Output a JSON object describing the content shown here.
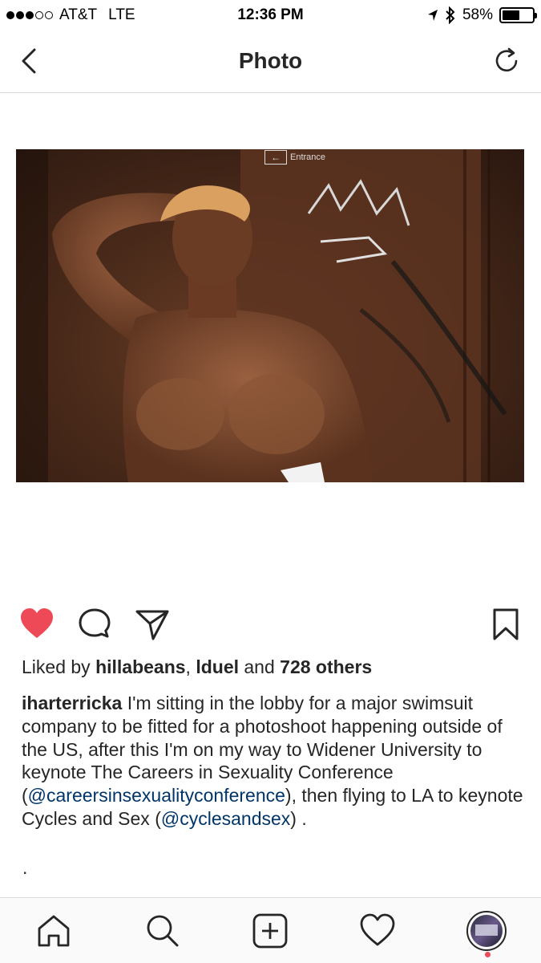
{
  "status_bar": {
    "carrier": "AT&T",
    "network": "LTE",
    "time": "12:36 PM",
    "battery_percent": "58%",
    "battery_level": 0.58,
    "signal_bars_filled": 3,
    "signal_bars_total": 5,
    "icons": [
      "location-arrow-icon",
      "bluetooth-icon",
      "battery-icon"
    ]
  },
  "nav": {
    "title": "Photo",
    "back_icon": "chevron-left-icon",
    "refresh_icon": "refresh-icon"
  },
  "photo": {
    "sign_text": "Entrance",
    "sign_icon": "arrow-left-icon"
  },
  "actions": {
    "like_icon": "heart-filled-icon",
    "like_color": "#ed4956",
    "comment_icon": "comment-icon",
    "share_icon": "paper-plane-icon",
    "save_icon": "bookmark-icon"
  },
  "likes": {
    "prefix": "Liked by ",
    "user1": "hillabeans",
    "separator": ", ",
    "user2": "lduel",
    "middle": " and ",
    "others": "728 others"
  },
  "caption": {
    "username": "iharterricka",
    "text1": " I'm sitting in the lobby for a major swimsuit company to be fitted for a photoshoot happening outside of the US, after this I'm on my way to Widener University to keynote The Careers in Sexuality Conference (",
    "mention1": "@careersinsexualityconference",
    "text2": "), then flying to LA to keynote Cycles and Sex (",
    "mention2": "@cyclesandsex",
    "text3": ") .",
    "trailing": ".",
    "mention_color": "#003569"
  },
  "tab_bar": {
    "icons": [
      "home-icon",
      "search-icon",
      "add-post-icon",
      "activity-heart-icon",
      "profile-avatar"
    ]
  }
}
